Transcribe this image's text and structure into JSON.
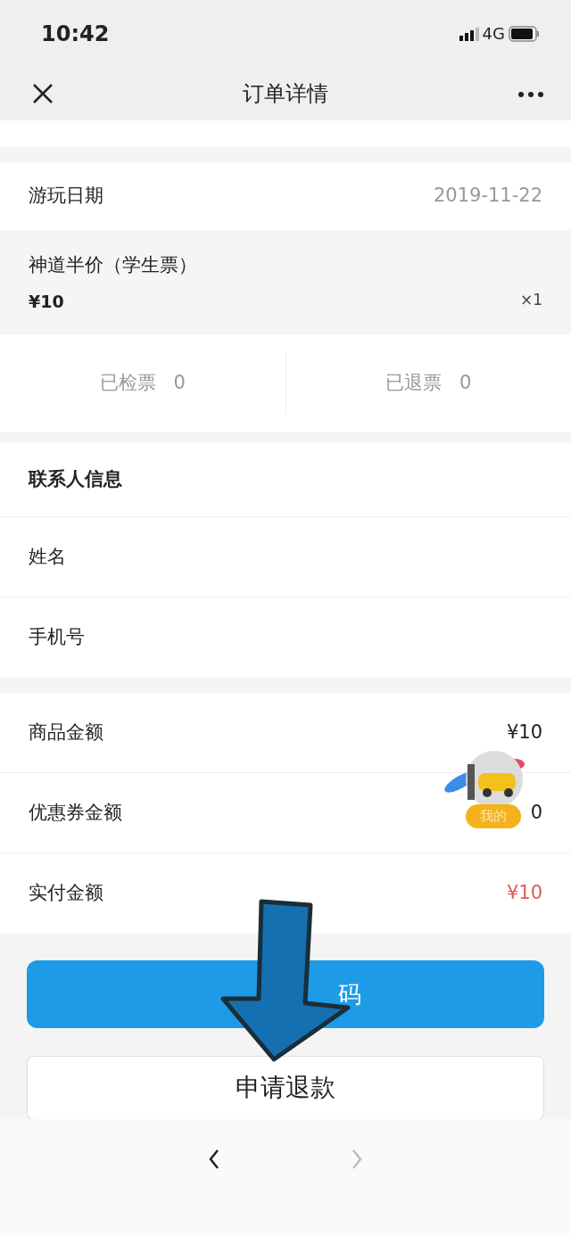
{
  "status_bar": {
    "time": "10:42",
    "network": "4G"
  },
  "nav": {
    "title": "订单详情"
  },
  "visit": {
    "label": "游玩日期",
    "value": "2019-11-22"
  },
  "ticket": {
    "name": "神道半价（学生票）",
    "price": "¥10",
    "quantity": "×1"
  },
  "counts": [
    {
      "label": "已检票",
      "value": "0"
    },
    {
      "label": "已退票",
      "value": "0"
    }
  ],
  "contact": {
    "heading": "联系人信息",
    "fields": [
      {
        "label": "姓名"
      },
      {
        "label": "手机号"
      }
    ]
  },
  "amounts": [
    {
      "label": "商品金额",
      "value": "¥10",
      "highlight": false
    },
    {
      "label": "优惠券金额",
      "value": "0",
      "highlight": false
    },
    {
      "label": "实付金额",
      "value": "¥10",
      "highlight": true
    }
  ],
  "floating_widget": {
    "badge": "我的"
  },
  "view_button": {
    "parts": [
      "码"
    ]
  },
  "refund_button": {
    "label": "申请退款"
  },
  "toolbar": {
    "back_disabled": false,
    "forward_disabled": true
  }
}
